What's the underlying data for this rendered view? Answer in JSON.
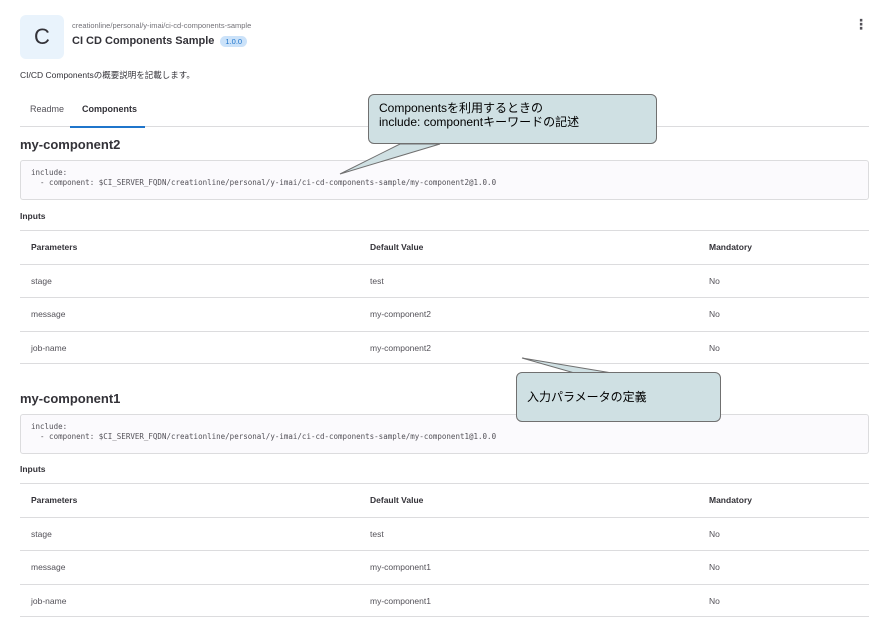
{
  "header": {
    "avatar_letter": "C",
    "path": "creationline/personal/y-imai/ci-cd-components-sample",
    "title": "CI CD Components Sample",
    "version": "1.0.0",
    "menu_icon": "kebab-vertical-icon"
  },
  "description": "CI/CD Componentsの概要説明を記載します。",
  "tabs": [
    {
      "label": "Readme",
      "active": false
    },
    {
      "label": "Components",
      "active": true
    }
  ],
  "components": [
    {
      "name": "my-component2",
      "code": "include:\n  - component: $CI_SERVER_FQDN/creationline/personal/y-imai/ci-cd-components-sample/my-component2@1.0.0",
      "inputs_label": "Inputs",
      "columns": [
        "Parameters",
        "Default Value",
        "Mandatory"
      ],
      "rows": [
        [
          "stage",
          "test",
          "No"
        ],
        [
          "message",
          "my-component2",
          "No"
        ],
        [
          "job-name",
          "my-component2",
          "No"
        ]
      ]
    },
    {
      "name": "my-component1",
      "code": "include:\n  - component: $CI_SERVER_FQDN/creationline/personal/y-imai/ci-cd-components-sample/my-component1@1.0.0",
      "inputs_label": "Inputs",
      "columns": [
        "Parameters",
        "Default Value",
        "Mandatory"
      ],
      "rows": [
        [
          "stage",
          "test",
          "No"
        ],
        [
          "message",
          "my-component1",
          "No"
        ],
        [
          "job-name",
          "my-component1",
          "No"
        ]
      ]
    }
  ],
  "annotations": {
    "include_callout_line1": "Componentsを利用するときの",
    "include_callout_line2": "include: componentキーワードの記述",
    "inputs_callout": "入力パラメータの定義",
    "fill_color": "#cfe0e3"
  }
}
